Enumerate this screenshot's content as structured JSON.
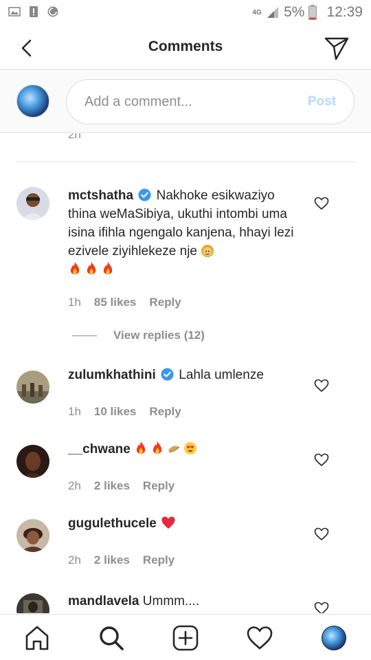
{
  "status_bar": {
    "network": "4G",
    "battery": "5%",
    "time": "12:39"
  },
  "header": {
    "title": "Comments"
  },
  "add_comment": {
    "placeholder": "Add a comment...",
    "post_label": "Post"
  },
  "previous_time": "2h",
  "comments": [
    {
      "username": "mctshatha",
      "verified": true,
      "text": "Nakhoke esikwaziyo thina weMaSibiya, ukuthi intombi uma isina ifihla ngengalo kanjena, hhayi lezi ezivele ziyihlekeze nje",
      "time": "1h",
      "likes": "85 likes",
      "reply": "Reply",
      "view_replies": "View replies (12)"
    },
    {
      "username": "zulumkhathini",
      "verified": true,
      "text": "Lahla umlenze",
      "time": "1h",
      "likes": "10 likes",
      "reply": "Reply"
    },
    {
      "username": "__chwane",
      "verified": false,
      "text": "",
      "time": "2h",
      "likes": "2 likes",
      "reply": "Reply"
    },
    {
      "username": "gugulethucele",
      "verified": false,
      "text": "",
      "time": "2h",
      "likes": "2 likes",
      "reply": "Reply"
    },
    {
      "username": "mandlavela",
      "verified": false,
      "text": "Ummm...."
    }
  ],
  "colors": {
    "accent": "#3897f0",
    "post_disabled": "#b3dbff",
    "secondary_text": "#8e8e8e"
  },
  "icons": [
    "back-arrow-icon",
    "direct-send-icon",
    "heart-icon",
    "home-icon",
    "search-icon",
    "add-post-icon",
    "activity-heart-icon",
    "verified-badge-icon"
  ]
}
